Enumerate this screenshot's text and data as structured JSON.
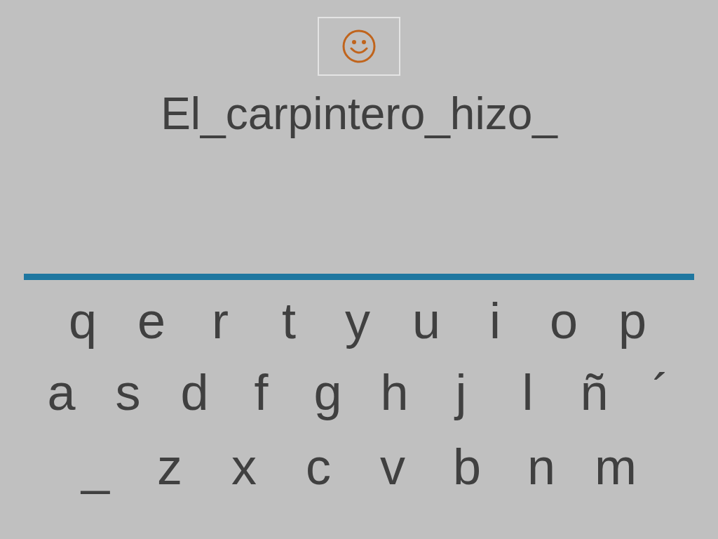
{
  "sentence": "El_carpintero_hizo_",
  "keyboard": {
    "rows": [
      [
        "q",
        "e",
        "r",
        "t",
        "y",
        "u",
        "i",
        "o",
        "p"
      ],
      [
        "a",
        "s",
        "d",
        "f",
        "g",
        "h",
        "j",
        "l",
        "ñ",
        "´"
      ],
      [
        "_",
        "z",
        "x",
        "c",
        "v",
        "b",
        "n",
        "m"
      ]
    ]
  }
}
